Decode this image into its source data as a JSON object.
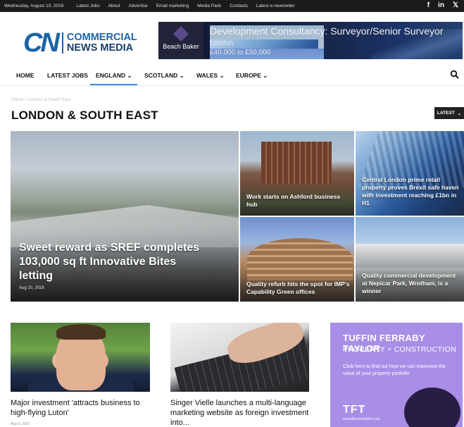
{
  "topbar": {
    "date": "Wednesday, August 10, 2016",
    "links": [
      "Latest Jobs",
      "About",
      "Advertise",
      "Email marketing",
      "Media Pack",
      "Contacts",
      "Latest e-newsletter"
    ],
    "social": {
      "facebook": "f",
      "linkedin": "in",
      "twitter": "𝕏"
    }
  },
  "logo": {
    "mark": "CN",
    "line1": "COMMERCIAL",
    "line2": "NEWS MEDIA"
  },
  "banner": {
    "brand": "Beach Baker",
    "title": "Development Consultancy: Surveyor/Senior Surveyor",
    "location": "London",
    "salary": "£40,000 to £50,000"
  },
  "nav": {
    "items": [
      "HOME",
      "LATEST JOBS",
      "ENGLAND ⌄",
      "SCOTLAND ⌄",
      "WALES ⌄",
      "EUROPE ⌄"
    ],
    "active_index": 2
  },
  "breadcrumb": "Home  ›  London & South East",
  "page_title": "LONDON & SOUTH EAST",
  "sort_label": "LATEST",
  "featured": {
    "main": {
      "title": "Sweet reward as SREF completes 103,000 sq ft Innovative Bites letting",
      "date": "Aug 10, 2016"
    },
    "tiles": [
      {
        "title": "Work starts on Ashford business hub"
      },
      {
        "title": "Central London prime retail property proves Brexit safe haven with investment reaching £1bn in H1"
      },
      {
        "title": "Quality refurb hits the spot for IMP's Capability Green offices"
      },
      {
        "title": "Quality commercial development at Nepicar Park, Wrotham, is a winner"
      }
    ]
  },
  "cards": [
    {
      "title": "Major investment 'attracts business to high-flying Luton'",
      "date": "Aug 9, 2016"
    },
    {
      "title": "Singer Vielle launches a multi-language marketing website as foreign investment into..."
    }
  ],
  "side_ad": {
    "line1": "TUFFIN FERRABY TAYLOR",
    "line2": "PROPERTY + CONSTRUCTION",
    "body": "Click here to find out how we can maximise the value of your property portfolio",
    "brand": "TFT",
    "url": "www.tftconsultants.com"
  },
  "colors": {
    "accent": "#1a64a8",
    "nav_active": "#3d8fd6",
    "ad_purple": "#a88ee6"
  }
}
